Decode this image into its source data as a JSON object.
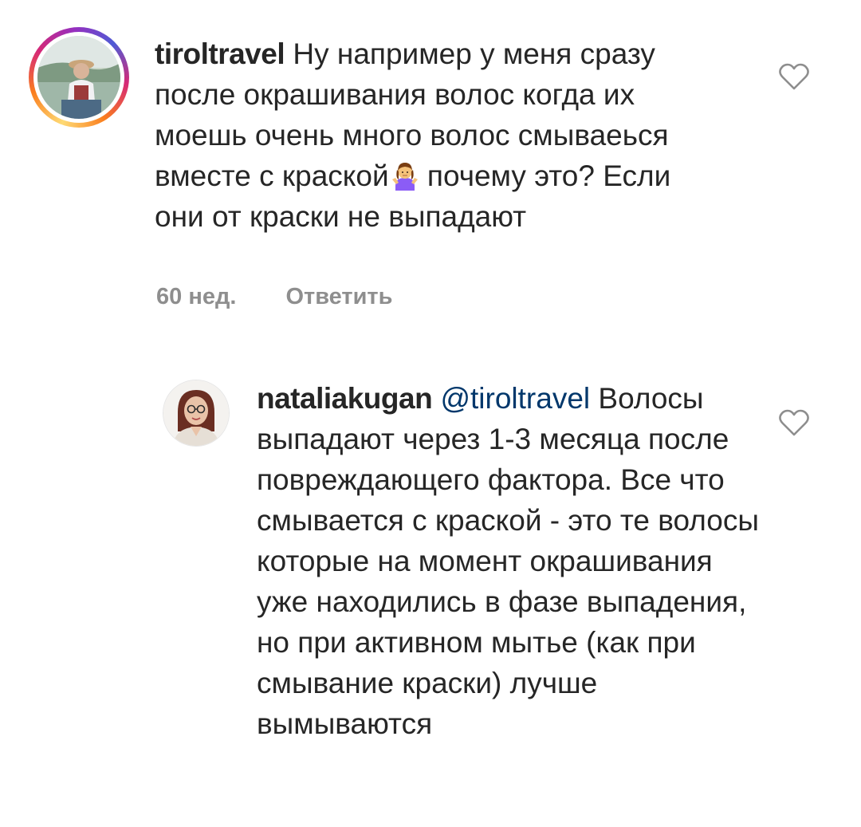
{
  "comments": [
    {
      "username": "tiroltravel",
      "text_before_emoji": "Ну например у меня сразу после окрашивания волос когда их моешь очень много волос смываеься вместе с краской",
      "emoji": "person-shrugging-emoji",
      "text_after_emoji": "почему это? Если они от краски не выпадают",
      "time": "60 нед.",
      "reply_label": "Ответить",
      "avatar_story_ring": true,
      "like_icon": "heart-outline-icon"
    },
    {
      "username": "nataliakugan",
      "mention": "@tiroltravel",
      "text": "Волосы выпадают через 1-3 месяца после повреждающего фактора. Все что смывается с краской - это те волосы которые на момент окрашивания уже находились в фазе выпадения, но при активном мытье (как при смывание краски) лучше вымываются",
      "like_icon": "heart-outline-icon"
    }
  ],
  "colors": {
    "text": "#262626",
    "secondary_text": "#8e8e8e",
    "mention": "#00376b"
  }
}
